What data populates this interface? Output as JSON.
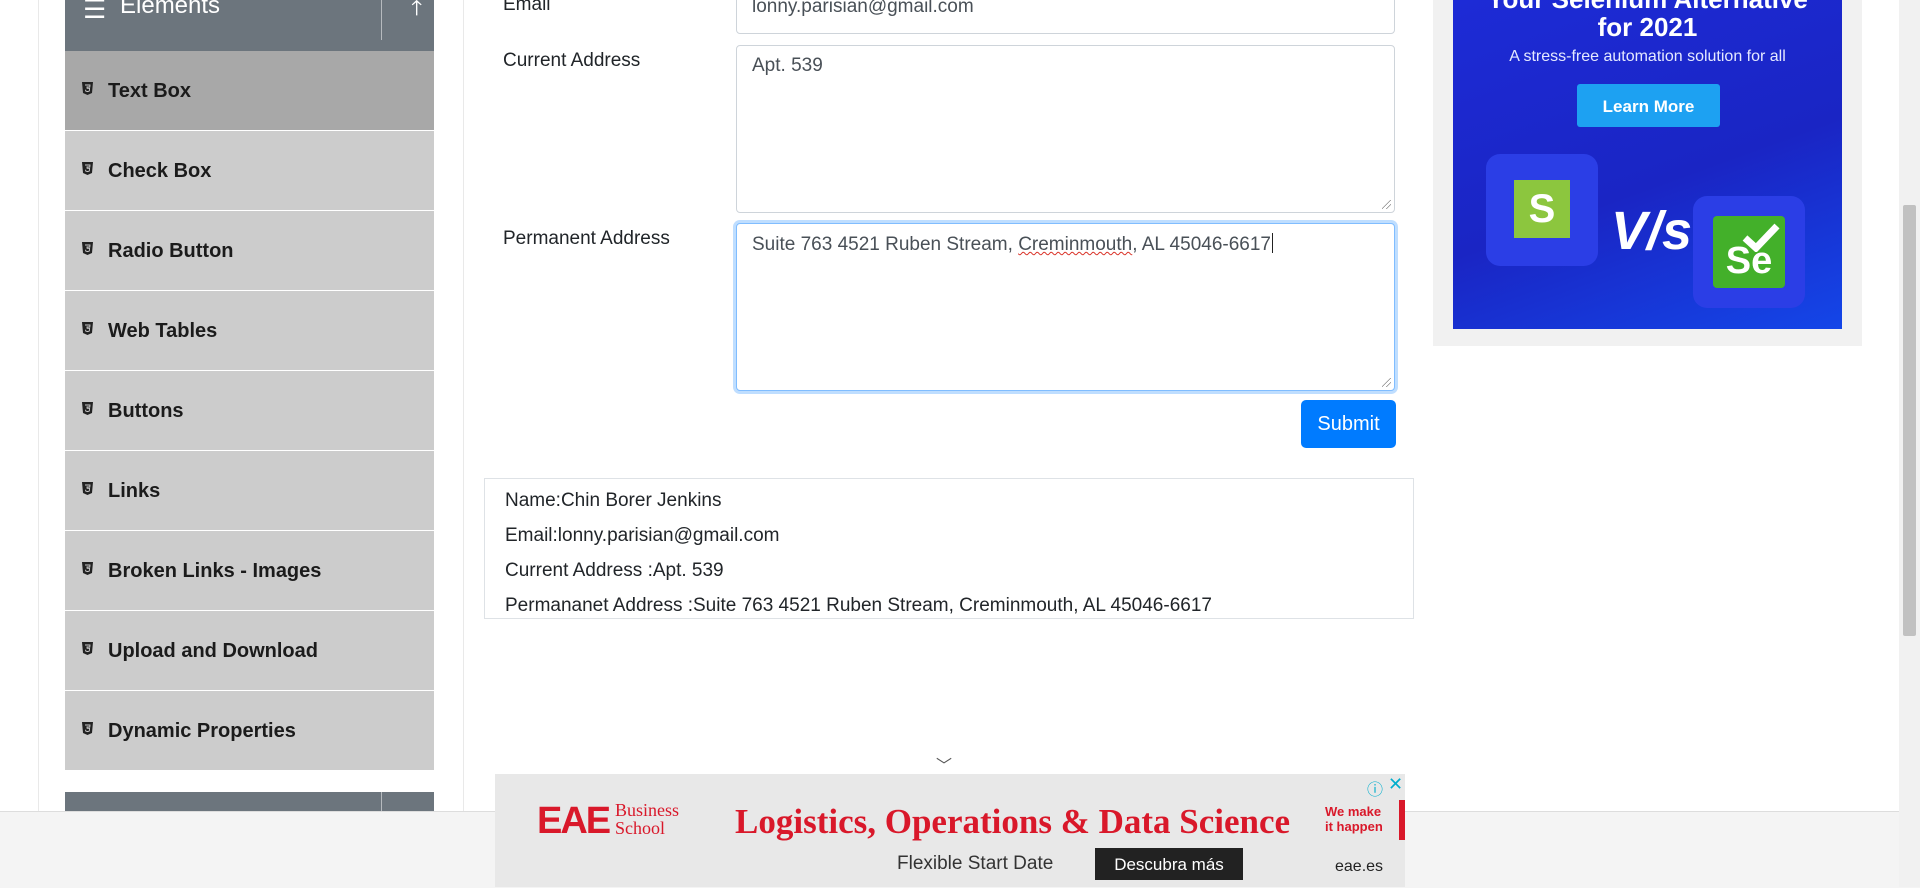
{
  "sidebar": {
    "group_title": "Elements",
    "items": [
      {
        "label": "Text Box",
        "active": true
      },
      {
        "label": "Check Box"
      },
      {
        "label": "Radio Button"
      },
      {
        "label": "Web Tables"
      },
      {
        "label": "Buttons"
      },
      {
        "label": "Links"
      },
      {
        "label": "Broken Links - Images"
      },
      {
        "label": "Upload and Download"
      },
      {
        "label": "Dynamic Properties"
      }
    ]
  },
  "form": {
    "email_label": "Email",
    "email_value": "lonny.parisian@gmail.com",
    "current_address_label": "Current Address",
    "current_address_value": "Apt. 539",
    "permanent_address_label": "Permanent Address",
    "permanent_address_part1": "Suite 763 4521 Ruben Stream, ",
    "permanent_address_misspelled": "Creminmouth",
    "permanent_address_part2": ", AL 45046-6617",
    "submit_label": "Submit"
  },
  "output": {
    "name": "Name:Chin Borer Jenkins",
    "email": "Email:lonny.parisian@gmail.com",
    "current_address": "Current Address :Apt. 539",
    "permanent_address": "Permananet Address :Suite 763 4521 Ruben Stream, Creminmouth, AL 45046-6617"
  },
  "side_ad": {
    "headline_line1": "Your Selenium Alternative",
    "headline_line2": "for 2021",
    "subtitle": "A stress-free automation solution for all",
    "cta": "Learn More",
    "vs": "V/s",
    "logo_left_letter": "S",
    "logo_right_letters": "Se",
    "brand_color": "#1d2bd6",
    "cta_color": "#1da1f2"
  },
  "bottom_ad": {
    "logo": "EAE",
    "school_line1": "Business",
    "school_line2": "School",
    "headline": "Logistics, Operations & Data Science",
    "tag_line1": "We make",
    "tag_line2": "it happen",
    "subline": "Flexible Start Date",
    "cta": "Descubra más",
    "domain": "eae.es",
    "brand_color": "#d9182a"
  },
  "colors": {
    "accent": "#007bff",
    "sidebar_item_bg": "#cccccc",
    "sidebar_active_bg": "#a8a8a8",
    "group_header_bg": "#6c757d"
  }
}
